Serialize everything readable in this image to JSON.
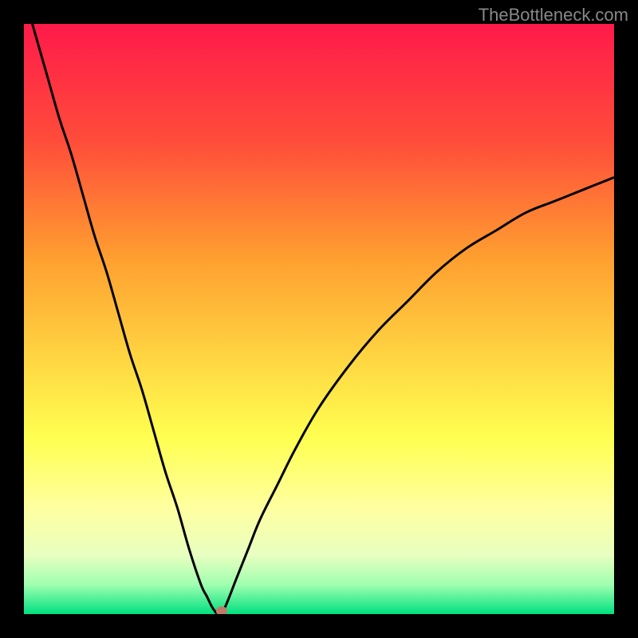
{
  "watermark": "TheBottleneck.com",
  "chart_data": {
    "type": "line",
    "title": "",
    "xlabel": "",
    "ylabel": "",
    "xlim": [
      0,
      100
    ],
    "ylim": [
      0,
      100
    ],
    "curve_minimum_x": 33,
    "series": [
      {
        "name": "bottleneck-curve",
        "x": [
          0,
          2,
          4,
          6,
          8,
          10,
          12,
          14,
          16,
          18,
          20,
          22,
          24,
          26,
          28,
          30,
          31,
          32,
          33,
          34,
          36,
          38,
          40,
          43,
          46,
          50,
          55,
          60,
          65,
          70,
          75,
          80,
          85,
          90,
          95,
          100
        ],
        "y": [
          105,
          98,
          91,
          84,
          78,
          71,
          64,
          58,
          51,
          44,
          38,
          31,
          24,
          18,
          11,
          5,
          3,
          1,
          0,
          1,
          6,
          11,
          16,
          22,
          28,
          35,
          42,
          48,
          53,
          58,
          62,
          65,
          68,
          70,
          72,
          74
        ]
      }
    ],
    "marker": {
      "x": 33.5,
      "y": 0.5,
      "color": "#c17a6a"
    },
    "gradient_stops": [
      {
        "offset": 0,
        "color": "#ff1a4a"
      },
      {
        "offset": 20,
        "color": "#ff4d3a"
      },
      {
        "offset": 40,
        "color": "#ffa030"
      },
      {
        "offset": 55,
        "color": "#ffd040"
      },
      {
        "offset": 70,
        "color": "#ffff50"
      },
      {
        "offset": 82,
        "color": "#ffffa0"
      },
      {
        "offset": 90,
        "color": "#e8ffc0"
      },
      {
        "offset": 95,
        "color": "#a0ffb0"
      },
      {
        "offset": 100,
        "color": "#00e080"
      }
    ]
  }
}
